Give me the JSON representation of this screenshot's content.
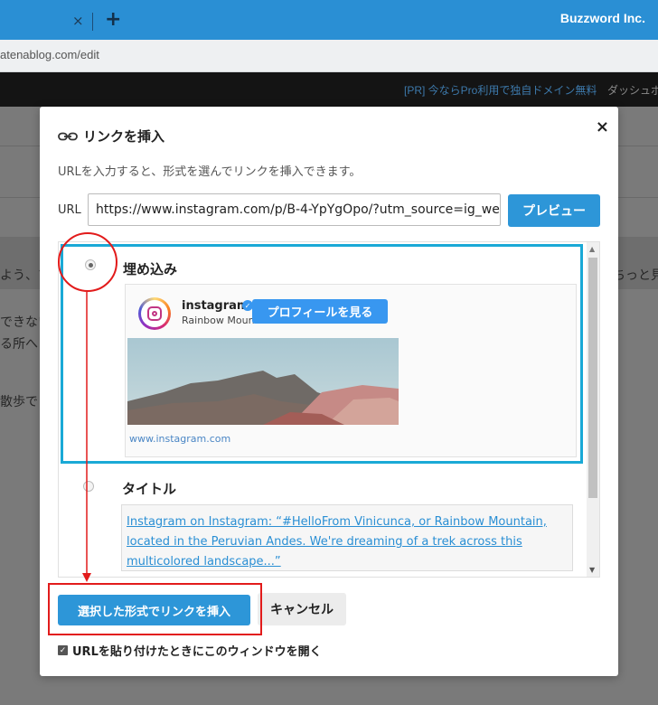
{
  "browser": {
    "tab_close": "×",
    "tab_new": "+",
    "brand": "Buzzword Inc.",
    "address": "atenablog.com/edit"
  },
  "blog_bar": {
    "promo": "[PR] 今ならPro利用で独自ドメイン無料",
    "dashboard": "ダッシュボ"
  },
  "background_text": {
    "line1_left": "よう、マ",
    "line1_right": "ちっと見",
    "line2": "できない",
    "line3": "る所へ",
    "line4": "散歩で"
  },
  "dialog": {
    "title": "リンクを挿入",
    "close": "×",
    "help": "URLを入力すると、形式を選んでリンクを挿入できます。",
    "url_label": "URL",
    "url_value": "https://www.instagram.com/p/B-4-YpYgOpo/?utm_source=ig_we",
    "preview_label": "プレビュー",
    "options": [
      {
        "label": "埋め込み",
        "selected": true
      },
      {
        "label": "タイトル",
        "selected": false
      }
    ],
    "embed": {
      "account": "instagram",
      "sub": "Rainbow Mount",
      "profile_button": "プロフィールを見る",
      "site": "www.instagram.com"
    },
    "title_link_text": "Instagram on Instagram: “#HelloFrom Vinicunca, or Rainbow Mountain, located in the Peruvian Andes. We're dreaming of a trek across this multicolored landscape...”",
    "insert_label": "選択した形式でリンクを挿入",
    "cancel_label": "キャンセル",
    "open_on_paste_label": "URLを貼り付けたときにこのウィンドウを開く",
    "open_on_paste_checked": true
  },
  "colors": {
    "tabbar": "#2a8fd4",
    "primary_button": "#2d96d8",
    "embed_border": "#1aa9d6",
    "annotation": "#e21b1b"
  }
}
